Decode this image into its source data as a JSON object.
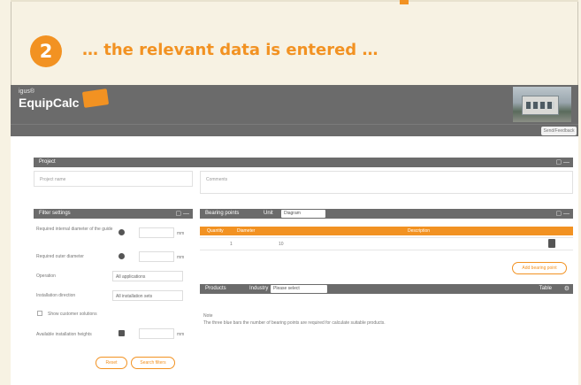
{
  "slide": {
    "step_number": "2",
    "step_title": "… the relevant data is entered …"
  },
  "app": {
    "brand_small": "igus®",
    "brand": "EquipCalc",
    "header_button": "Send/Feedback",
    "project_panel": {
      "title": "Project",
      "field_project_name": "Project name",
      "field_comments": "Comments"
    },
    "filter_settings": {
      "title": "Filter settings",
      "row1_label": "Required internal diameter of the guide",
      "row1_unit": "mm",
      "row2_label": "Required outer diameter",
      "row2_unit": "mm",
      "row3_label": "Operation",
      "row3_value": "All applications",
      "row4_label": "Installation direction",
      "row4_value": "All installation sets",
      "checkbox_label": "Show customer solutions",
      "row5_label": "Available installation heights",
      "row5_unit": "mm",
      "button_reset": "Reset",
      "button_search": "Search filters"
    },
    "bearing_panel": {
      "title": "Bearing points",
      "unit_label": "Unit",
      "unit_value": "Diagram",
      "col_1": "Quantity",
      "col_2": "Diameter",
      "col_3": "Description",
      "row_qty": "1",
      "row_diameter": "",
      "row_desc": "10",
      "add_button": "Add bearing point"
    },
    "products_panel": {
      "title": "Products",
      "filter_label": "Industry",
      "filter_value": "Please select",
      "right_label": "Table",
      "note_title": "Note",
      "note_text": "The three blue bars the number of bearing points are required for calculate suitable products."
    }
  }
}
